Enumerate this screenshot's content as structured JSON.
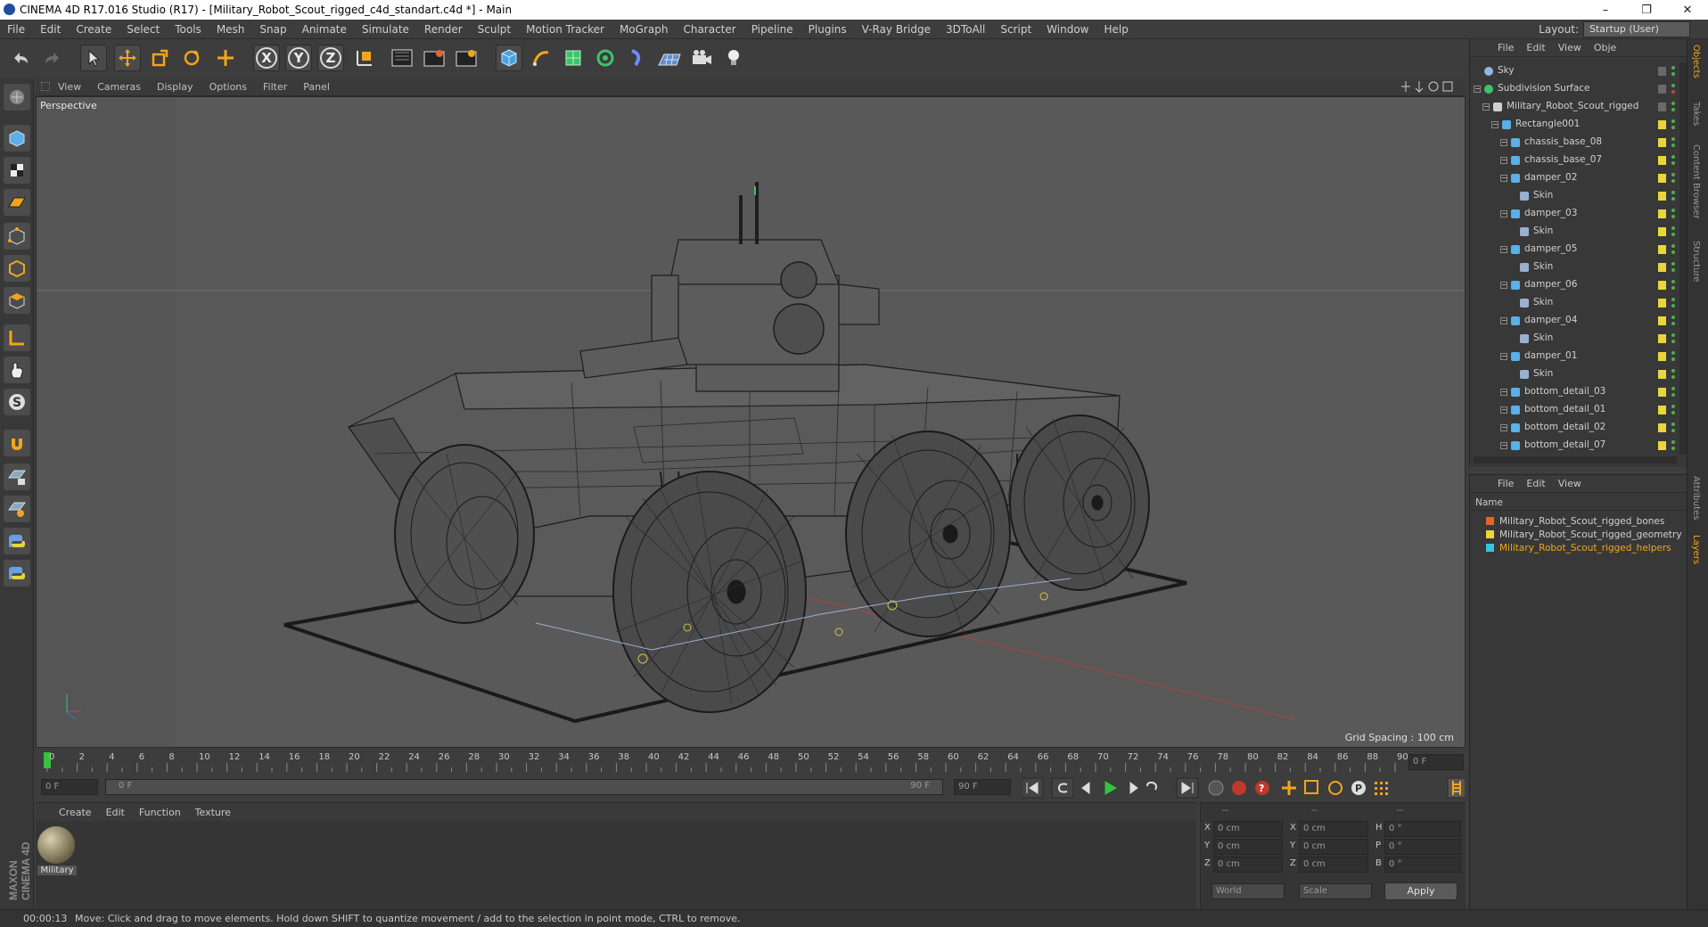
{
  "window": {
    "title": "CINEMA 4D R17.016 Studio (R17) - [Military_Robot_Scout_rigged_c4d_standart.c4d *] - Main",
    "controls": [
      "–",
      "❐",
      "✕"
    ]
  },
  "menubar": {
    "items": [
      "File",
      "Edit",
      "Create",
      "Select",
      "Tools",
      "Mesh",
      "Snap",
      "Animate",
      "Simulate",
      "Render",
      "Sculpt",
      "Motion Tracker",
      "MoGraph",
      "Character",
      "Pipeline",
      "Plugins",
      "V-Ray Bridge",
      "3DToAll",
      "Script",
      "Window",
      "Help"
    ],
    "layout_label": "Layout:",
    "layout_value": "Startup (User)"
  },
  "toolbar": {
    "axis_x": "X",
    "axis_y": "Y",
    "axis_z": "Z",
    "icons": [
      "undo-icon",
      "redo-icon",
      "select-icon",
      "move-icon",
      "scale-icon",
      "rotate-icon",
      "live-select-icon",
      "x-axis-icon",
      "y-axis-icon",
      "z-axis-icon",
      "coordinate-system-icon",
      "render-view-icon",
      "render-picture-viewer-icon",
      "edit-render-settings-icon",
      "cube-icon",
      "pen-icon",
      "subdivision-icon",
      "array-icon",
      "deformer-icon",
      "floor-icon",
      "camera-icon",
      "light-icon"
    ]
  },
  "viewport": {
    "menu": [
      "View",
      "Cameras",
      "Display",
      "Options",
      "Filter",
      "Panel"
    ],
    "label": "Perspective",
    "grid_spacing": "Grid Spacing : 100 cm"
  },
  "timeline": {
    "ticks": [
      "0",
      "2",
      "4",
      "6",
      "8",
      "10",
      "12",
      "14",
      "16",
      "18",
      "20",
      "22",
      "24",
      "26",
      "28",
      "30",
      "32",
      "34",
      "36",
      "38",
      "40",
      "42",
      "44",
      "46",
      "48",
      "50",
      "52",
      "54",
      "56",
      "58",
      "60",
      "62",
      "64",
      "66",
      "68",
      "70",
      "72",
      "74",
      "76",
      "78",
      "80",
      "82",
      "84",
      "86",
      "88",
      "90"
    ],
    "current_frame": "0 F"
  },
  "anim": {
    "start_field": "0 F",
    "range_start": "0 F",
    "range_end": "90 F",
    "end_field": "90 F"
  },
  "material_panel": {
    "menu": [
      "Create",
      "Edit",
      "Function",
      "Texture"
    ],
    "material_name": "Military"
  },
  "coords": {
    "header": [
      "--",
      "--",
      "--"
    ],
    "rows": [
      {
        "a": "X",
        "av": "0 cm",
        "b": "X",
        "bv": "0 cm",
        "c": "H",
        "cv": "0 °"
      },
      {
        "a": "Y",
        "av": "0 cm",
        "b": "Y",
        "bv": "0 cm",
        "c": "P",
        "cv": "0 °"
      },
      {
        "a": "Z",
        "av": "0 cm",
        "b": "Z",
        "bv": "0 cm",
        "c": "B",
        "cv": "0 °"
      }
    ],
    "world": "World",
    "scale": "Scale",
    "apply": "Apply"
  },
  "statusbar": {
    "time": "00:00:13",
    "message": "Move: Click and drag to move elements. Hold down SHIFT to quantize movement / add to the selection in point mode, CTRL to remove."
  },
  "object_manager": {
    "menu": [
      "File",
      "Edit",
      "View",
      "Obje"
    ],
    "objects": [
      {
        "name": "Sky",
        "indent": 0,
        "kind": "sky"
      },
      {
        "name": "Subdivision Surface",
        "indent": 0,
        "kind": "subd"
      },
      {
        "name": "Military_Robot_Scout_rigged",
        "indent": 1,
        "kind": "null"
      },
      {
        "name": "Rectangle001",
        "indent": 2,
        "kind": "joint"
      },
      {
        "name": "chassis_base_08",
        "indent": 3,
        "kind": "joint"
      },
      {
        "name": "chassis_base_07",
        "indent": 3,
        "kind": "joint"
      },
      {
        "name": "damper_02",
        "indent": 3,
        "kind": "joint"
      },
      {
        "name": "Skin",
        "indent": 4,
        "kind": "skin"
      },
      {
        "name": "damper_03",
        "indent": 3,
        "kind": "joint"
      },
      {
        "name": "Skin",
        "indent": 4,
        "kind": "skin"
      },
      {
        "name": "damper_05",
        "indent": 3,
        "kind": "joint"
      },
      {
        "name": "Skin",
        "indent": 4,
        "kind": "skin"
      },
      {
        "name": "damper_06",
        "indent": 3,
        "kind": "joint"
      },
      {
        "name": "Skin",
        "indent": 4,
        "kind": "skin"
      },
      {
        "name": "damper_04",
        "indent": 3,
        "kind": "joint"
      },
      {
        "name": "Skin",
        "indent": 4,
        "kind": "skin"
      },
      {
        "name": "damper_01",
        "indent": 3,
        "kind": "joint"
      },
      {
        "name": "Skin",
        "indent": 4,
        "kind": "skin"
      },
      {
        "name": "bottom_detail_03",
        "indent": 3,
        "kind": "joint"
      },
      {
        "name": "bottom_detail_01",
        "indent": 3,
        "kind": "joint"
      },
      {
        "name": "bottom_detail_02",
        "indent": 3,
        "kind": "joint"
      },
      {
        "name": "bottom_detail_07",
        "indent": 3,
        "kind": "joint"
      }
    ]
  },
  "layer_manager": {
    "menu": [
      "File",
      "Edit",
      "View"
    ],
    "header": "Name",
    "layers": [
      {
        "name": "Military_Robot_Scout_rigged_bones",
        "color": "#e0662b"
      },
      {
        "name": "Military_Robot_Scout_rigged_geometry",
        "color": "#e8d73a"
      },
      {
        "name": "Military_Robot_Scout_rigged_helpers",
        "color": "#35c6e0"
      }
    ]
  },
  "right_tabs": [
    "Objects",
    "Takes",
    "Content Browser",
    "Structure",
    "Attributes",
    "Layers"
  ],
  "brand": "MAXON CINEMA 4D",
  "colors": {
    "accent_orange": "#f2a51c",
    "selected_layer": "#f2a51c",
    "play_green": "#35c23c"
  }
}
